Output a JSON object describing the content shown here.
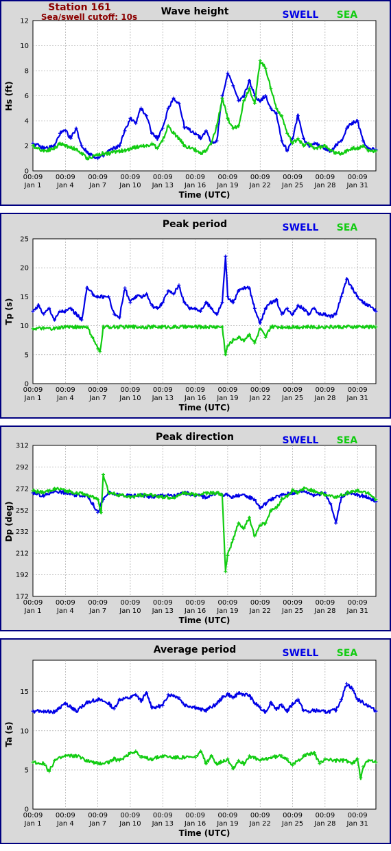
{
  "header": {
    "station": "Station 161",
    "cutoff": "Sea/swell cutoff: 10s"
  },
  "legend": {
    "swell": "SWELL",
    "sea": "SEA"
  },
  "colors": {
    "swell": "#0000e6",
    "sea": "#11cc11",
    "frame": "#000080",
    "panel_bg": "#d9d9d9",
    "station_text": "#8b0000"
  },
  "chart_data": [
    {
      "type": "line",
      "title": "Wave height",
      "xlabel": "Time (UTC)",
      "ylabel": "Hs (ft)",
      "ylim": [
        0,
        12
      ],
      "yticks": [
        "0",
        "2",
        "4",
        "6",
        "8",
        "10",
        "12"
      ],
      "xticks": [
        {
          "time": "00:09",
          "date": "Jan 1"
        },
        {
          "time": "00:09",
          "date": "Jan 4"
        },
        {
          "time": "00:09",
          "date": "Jan 7"
        },
        {
          "time": "00:09",
          "date": "Jan 10"
        },
        {
          "time": "00:09",
          "date": "Jan 13"
        },
        {
          "time": "00:09",
          "date": "Jan 16"
        },
        {
          "time": "00:09",
          "date": "Jan 19"
        },
        {
          "time": "00:09",
          "date": "Jan 22"
        },
        {
          "time": "00:09",
          "date": "Jan 25"
        },
        {
          "time": "00:09",
          "date": "Jan 28"
        },
        {
          "time": "00:09",
          "date": "Jan 31"
        }
      ],
      "xlim_days": [
        1,
        32.7
      ],
      "grid": true,
      "legend": "top-right",
      "series": [
        {
          "name": "SWELL",
          "x": [
            1,
            2,
            3,
            3.5,
            4,
            4.5,
            5,
            5.5,
            6,
            7,
            7.5,
            8,
            9,
            9.5,
            10,
            10.5,
            11,
            11.5,
            12,
            12.5,
            13,
            13.5,
            14,
            14.5,
            15,
            16,
            16.5,
            17,
            17.5,
            18,
            18.5,
            19,
            19.5,
            20,
            20.5,
            21,
            21.5,
            22,
            22.5,
            23,
            23.5,
            24,
            24.5,
            25,
            25.5,
            26,
            26.5,
            27,
            28,
            28.5,
            29,
            29.5,
            30,
            30.5,
            31,
            31.5,
            32,
            32.7
          ],
          "values": [
            2.2,
            1.8,
            2.0,
            3.0,
            3.2,
            2.6,
            3.4,
            2.0,
            1.5,
            1.0,
            1.2,
            1.6,
            2.0,
            3.2,
            4.2,
            3.8,
            5.0,
            4.4,
            3.0,
            2.6,
            3.4,
            5.0,
            5.8,
            5.4,
            3.5,
            3.0,
            2.6,
            3.2,
            2.2,
            2.4,
            6.0,
            7.8,
            6.8,
            5.6,
            6.0,
            7.2,
            6.0,
            5.6,
            6.0,
            5.0,
            4.6,
            2.4,
            1.6,
            2.6,
            4.4,
            2.6,
            2.0,
            2.2,
            1.8,
            1.6,
            2.0,
            2.4,
            3.4,
            3.8,
            4.0,
            2.4,
            1.8,
            1.7
          ]
        },
        {
          "name": "SEA",
          "x": [
            1,
            2,
            3,
            3.5,
            4,
            4.5,
            5,
            5.5,
            6,
            7,
            7.5,
            8,
            9,
            9.5,
            10,
            10.5,
            11,
            11.5,
            12,
            12.5,
            13,
            13.5,
            14,
            14.5,
            15,
            16,
            16.5,
            17,
            17.5,
            18,
            18.5,
            19,
            19.5,
            20,
            20.5,
            21,
            21.5,
            22,
            22.5,
            23,
            23.5,
            24,
            24.5,
            25,
            25.5,
            26,
            26.5,
            27,
            28,
            28.5,
            29,
            29.5,
            30,
            30.5,
            31,
            31.5,
            32,
            32.7
          ],
          "values": [
            2.0,
            1.6,
            1.8,
            2.2,
            2.0,
            1.9,
            1.7,
            1.4,
            1.0,
            1.3,
            1.4,
            1.4,
            1.6,
            1.6,
            1.8,
            1.9,
            2.0,
            2.0,
            2.2,
            1.8,
            2.4,
            3.6,
            3.0,
            2.6,
            2.0,
            1.7,
            1.4,
            1.6,
            2.2,
            3.6,
            5.8,
            4.2,
            3.4,
            3.6,
            5.6,
            6.6,
            5.4,
            8.8,
            8.2,
            6.6,
            5.0,
            4.4,
            3.0,
            2.2,
            2.6,
            2.0,
            2.2,
            1.8,
            2.0,
            1.6,
            1.4,
            1.4,
            1.6,
            1.8,
            1.8,
            2.0,
            1.6,
            1.6
          ]
        }
      ]
    },
    {
      "type": "line",
      "title": "Peak period",
      "xlabel": "Time (UTC)",
      "ylabel": "Tp (s)",
      "ylim": [
        0,
        25
      ],
      "yticks": [
        "0",
        "5",
        "10",
        "15",
        "20",
        "25"
      ],
      "xticks": [
        {
          "time": "00:09",
          "date": "Jan 1"
        },
        {
          "time": "00:09",
          "date": "Jan 4"
        },
        {
          "time": "00:09",
          "date": "Jan 7"
        },
        {
          "time": "00:09",
          "date": "Jan 10"
        },
        {
          "time": "00:09",
          "date": "Jan 13"
        },
        {
          "time": "00:09",
          "date": "Jan 16"
        },
        {
          "time": "00:09",
          "date": "Jan 19"
        },
        {
          "time": "00:09",
          "date": "Jan 22"
        },
        {
          "time": "00:09",
          "date": "Jan 25"
        },
        {
          "time": "00:09",
          "date": "Jan 28"
        },
        {
          "time": "00:09",
          "date": "Jan 31"
        }
      ],
      "xlim_days": [
        1,
        32.7
      ],
      "grid": true,
      "legend": "top-right",
      "series": [
        {
          "name": "SWELL",
          "x": [
            1,
            1.5,
            2,
            2.5,
            3,
            3.5,
            4,
            4.5,
            5,
            5.5,
            6,
            6.5,
            7,
            7.5,
            8,
            8.5,
            9,
            9.5,
            10,
            10.5,
            11,
            11.5,
            12,
            12.5,
            13,
            13.5,
            14,
            14.5,
            15,
            15.5,
            16,
            16.5,
            17,
            17.5,
            18,
            18.5,
            18.8,
            19,
            19.5,
            20,
            20.5,
            21,
            21.5,
            22,
            22.5,
            23,
            23.5,
            24,
            24.5,
            25,
            25.5,
            26,
            26.5,
            27,
            27.5,
            28,
            28.5,
            29,
            29.5,
            30,
            30.5,
            31,
            31.5,
            32,
            32.7
          ],
          "values": [
            12.5,
            13.5,
            12,
            13,
            11,
            12.5,
            12.5,
            13,
            12,
            11,
            16.5,
            15.5,
            15,
            15,
            15,
            12,
            11.5,
            16.5,
            14,
            15,
            15,
            15.5,
            13.5,
            13,
            14,
            16,
            15.5,
            17,
            14,
            13,
            13,
            12.5,
            14,
            13,
            12,
            14,
            22,
            15,
            14,
            16,
            16.5,
            16.5,
            13,
            10.5,
            13,
            14,
            14.5,
            12,
            13,
            12,
            13.5,
            13,
            12,
            13,
            12,
            12,
            11.5,
            12,
            15,
            18,
            16.5,
            15,
            14,
            13.5,
            12.5
          ]
        },
        {
          "name": "SEA",
          "x": [
            1,
            2,
            3,
            4,
            5,
            6,
            6.5,
            7,
            7.2,
            7.5,
            8,
            9,
            10,
            11,
            12,
            13,
            14,
            15,
            16,
            17,
            18,
            18.5,
            18.8,
            19,
            19.5,
            20,
            20.5,
            21,
            21.5,
            22,
            22.5,
            23,
            24,
            24.5,
            25,
            25.5,
            26,
            27,
            28,
            29,
            30,
            31,
            32,
            32.7
          ],
          "values": [
            9.5,
            9.5,
            9.5,
            9.8,
            9.8,
            9.8,
            8,
            6,
            5.5,
            9.8,
            9.8,
            9.8,
            9.8,
            9.8,
            9.8,
            9.8,
            9.8,
            9.8,
            9.8,
            9.8,
            9.8,
            9.8,
            5,
            6.5,
            7.5,
            8,
            7.5,
            8.5,
            7,
            9.5,
            8,
            9.8,
            9.8,
            9.8,
            9.8,
            9.8,
            9.8,
            9.8,
            9.8,
            9.8,
            9.8,
            9.8,
            9.8,
            9.8
          ]
        }
      ]
    },
    {
      "type": "line",
      "title": "Peak direction",
      "xlabel": "Time (UTC)",
      "ylabel": "Dp (deg)",
      "ylim": [
        172,
        312
      ],
      "yticks": [
        "172",
        "192",
        "212",
        "232",
        "252",
        "272",
        "292",
        "312"
      ],
      "xticks": [
        {
          "time": "00:09",
          "date": "Jan 1"
        },
        {
          "time": "00:09",
          "date": "Jan 4"
        },
        {
          "time": "00:09",
          "date": "Jan 7"
        },
        {
          "time": "00:09",
          "date": "Jan 10"
        },
        {
          "time": "00:09",
          "date": "Jan 13"
        },
        {
          "time": "00:09",
          "date": "Jan 16"
        },
        {
          "time": "00:09",
          "date": "Jan 19"
        },
        {
          "time": "00:09",
          "date": "Jan 22"
        },
        {
          "time": "00:09",
          "date": "Jan 25"
        },
        {
          "time": "00:09",
          "date": "Jan 28"
        },
        {
          "time": "00:09",
          "date": "Jan 31"
        }
      ],
      "xlim_days": [
        1,
        32.7
      ],
      "grid": true,
      "legend": "top-right",
      "series": [
        {
          "name": "SWELL",
          "x": [
            1,
            2,
            3,
            4,
            5,
            6,
            6.5,
            7,
            7.5,
            8,
            9,
            10,
            11,
            12,
            13,
            14,
            15,
            16,
            17,
            18,
            18.5,
            19,
            19.5,
            20,
            21,
            21.5,
            22,
            22.5,
            23,
            24,
            25,
            26,
            27,
            28,
            28.5,
            29,
            29.5,
            30,
            31,
            32,
            32.7
          ],
          "values": [
            268,
            265,
            270,
            268,
            266,
            266,
            258,
            250,
            262,
            268,
            266,
            265,
            266,
            264,
            266,
            265,
            268,
            266,
            264,
            268,
            266,
            266,
            264,
            266,
            264,
            262,
            254,
            258,
            262,
            266,
            268,
            270,
            266,
            268,
            258,
            240,
            264,
            268,
            266,
            264,
            260
          ]
        },
        {
          "name": "SEA",
          "x": [
            1,
            2,
            3,
            4,
            5,
            6,
            7,
            7.3,
            7.5,
            8,
            9,
            10,
            11,
            12,
            13,
            14,
            15,
            16,
            17,
            18,
            18.5,
            18.8,
            19,
            19.5,
            20,
            20.5,
            21,
            21.5,
            22,
            22.5,
            23,
            23.5,
            24,
            24.5,
            25,
            25.5,
            26,
            27,
            28,
            29,
            30,
            31,
            32,
            32.7
          ],
          "values": [
            270,
            268,
            272,
            270,
            268,
            266,
            262,
            250,
            285,
            268,
            266,
            264,
            266,
            266,
            264,
            264,
            268,
            266,
            268,
            268,
            266,
            195,
            210,
            225,
            240,
            235,
            245,
            228,
            238,
            240,
            252,
            254,
            262,
            265,
            270,
            268,
            272,
            270,
            266,
            264,
            268,
            270,
            268,
            262
          ]
        }
      ]
    },
    {
      "type": "line",
      "title": "Average period",
      "xlabel": "Time (UTC)",
      "ylabel": "Ta (s)",
      "ylim": [
        0,
        19
      ],
      "yticks": [
        "0",
        "5",
        "10",
        "15"
      ],
      "xticks": [
        {
          "time": "00:09",
          "date": "Jan 1"
        },
        {
          "time": "00:09",
          "date": "Jan 4"
        },
        {
          "time": "00:09",
          "date": "Jan 7"
        },
        {
          "time": "00:09",
          "date": "Jan 10"
        },
        {
          "time": "00:09",
          "date": "Jan 13"
        },
        {
          "time": "00:09",
          "date": "Jan 16"
        },
        {
          "time": "00:09",
          "date": "Jan 19"
        },
        {
          "time": "00:09",
          "date": "Jan 22"
        },
        {
          "time": "00:09",
          "date": "Jan 25"
        },
        {
          "time": "00:09",
          "date": "Jan 28"
        },
        {
          "time": "00:09",
          "date": "Jan 31"
        }
      ],
      "xlim_days": [
        1,
        32.7
      ],
      "grid": true,
      "legend": "top-right",
      "series": [
        {
          "name": "SWELL",
          "x": [
            1,
            2,
            3,
            4,
            4.5,
            5,
            6,
            7,
            8,
            8.5,
            9,
            10,
            10.5,
            11,
            11.5,
            12,
            13,
            13.5,
            14,
            14.5,
            15,
            16,
            16.5,
            17,
            18,
            18.5,
            19,
            19.5,
            20,
            21,
            21.5,
            22,
            22.5,
            23,
            23.5,
            24,
            24.5,
            25,
            25.5,
            26,
            26.5,
            27,
            28,
            29,
            29.5,
            30,
            30.5,
            31,
            32,
            32.7
          ],
          "values": [
            12.5,
            12.5,
            12.4,
            13.5,
            13,
            12.5,
            13.6,
            14,
            13.5,
            12.8,
            14,
            14.2,
            14.6,
            13.8,
            14.8,
            13,
            13.2,
            14.6,
            14.5,
            14.2,
            13.3,
            13,
            12.7,
            12.6,
            13.5,
            14.2,
            14.7,
            14.2,
            14.8,
            14.5,
            13.5,
            13,
            12.4,
            13.6,
            12.8,
            13.3,
            12.5,
            13.4,
            14,
            12.6,
            12.4,
            12.6,
            12.4,
            12.6,
            14,
            16,
            15.4,
            14,
            13.2,
            12.5
          ]
        },
        {
          "name": "SEA",
          "x": [
            1,
            2,
            2.5,
            3,
            4,
            5,
            6,
            7,
            8,
            8.5,
            9,
            10,
            10.5,
            11,
            12,
            13,
            14,
            15,
            16,
            16.5,
            17,
            17.5,
            18,
            19,
            19.5,
            20,
            20.5,
            21,
            22,
            23,
            24,
            24.5,
            25,
            26,
            27,
            27.5,
            28,
            29,
            30,
            30.5,
            31,
            31.3,
            31.5,
            32,
            32.7
          ],
          "values": [
            6,
            5.8,
            4.8,
            6.2,
            6.8,
            6.8,
            6.2,
            5.8,
            6,
            6.4,
            6.2,
            7.2,
            7.4,
            6.6,
            6.4,
            6.8,
            6.6,
            6.6,
            6.6,
            7.4,
            5.8,
            6.8,
            5.8,
            6.4,
            5.2,
            6.2,
            5.8,
            6.8,
            6.2,
            6.6,
            6.8,
            6.4,
            5.6,
            6.8,
            7.2,
            5.8,
            6.4,
            6.2,
            6.2,
            5.8,
            6.4,
            4,
            5.4,
            6.2,
            6
          ]
        }
      ]
    }
  ]
}
